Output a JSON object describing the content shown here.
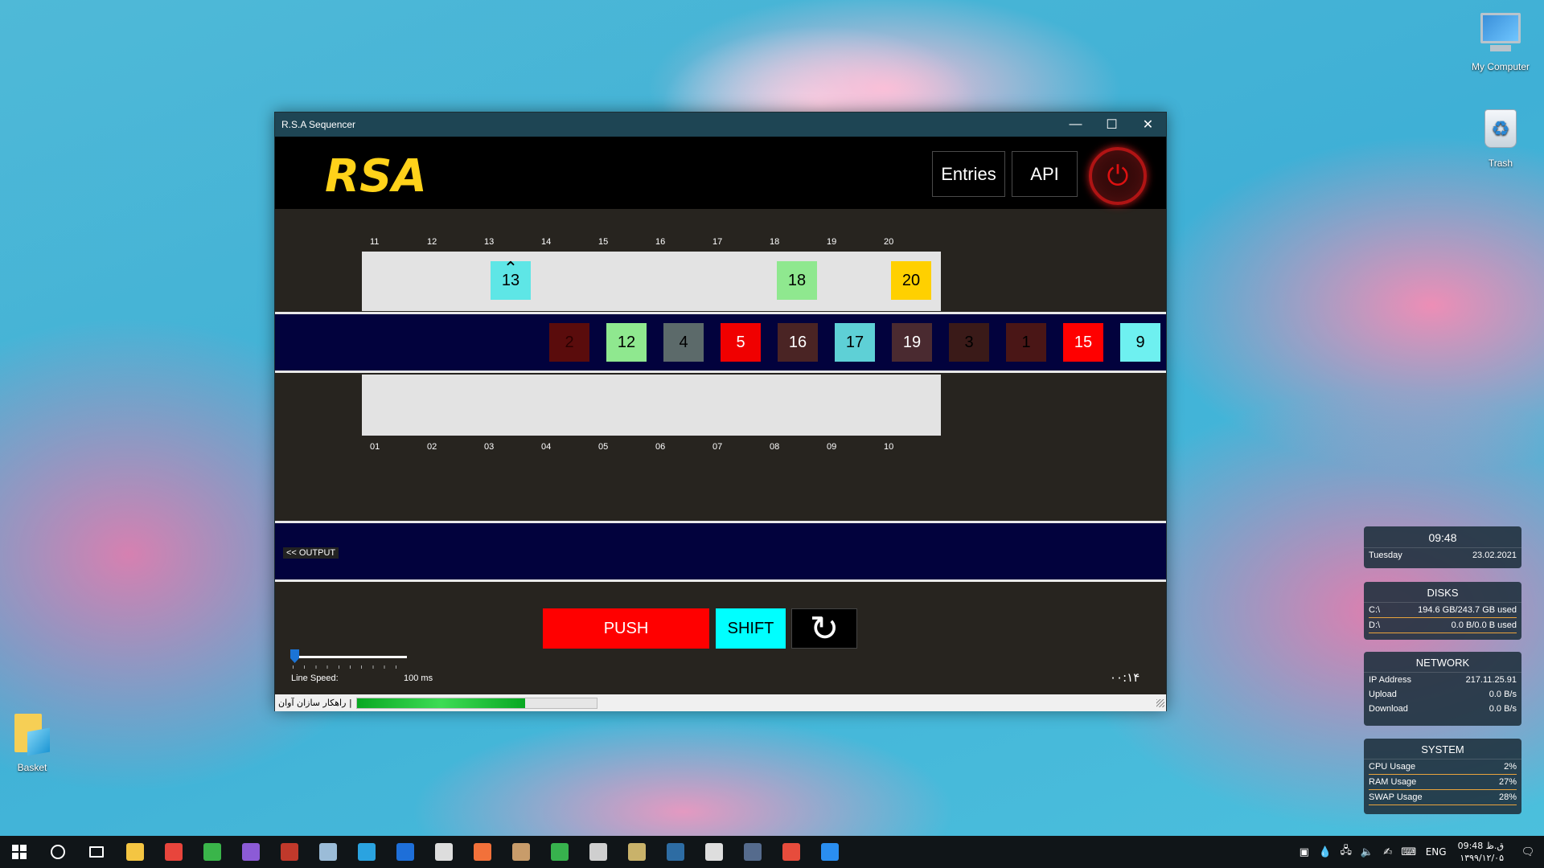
{
  "desktop": {
    "icons": [
      {
        "label": "My Computer"
      },
      {
        "label": "Trash"
      },
      {
        "label": "Basket"
      }
    ]
  },
  "window": {
    "title": "R.S.A Sequencer",
    "controls": {
      "minimize": "—",
      "maximize": "☐",
      "close": "✕"
    },
    "header": {
      "logo_text": "RSA",
      "entries_label": "Entries",
      "api_label": "API",
      "power_icon": "⏻"
    },
    "top_ticks": [
      "11",
      "12",
      "13",
      "14",
      "15",
      "16",
      "17",
      "18",
      "19",
      "20"
    ],
    "bottom_ticks": [
      "01",
      "02",
      "03",
      "04",
      "05",
      "06",
      "07",
      "08",
      "09",
      "10"
    ],
    "top_lane_boxes": [
      {
        "label": "13",
        "color": "#5ee6e6",
        "marker": "⌃"
      },
      {
        "label": "18",
        "color": "#8fe88f"
      },
      {
        "label": "20",
        "color": "#ffd000"
      }
    ],
    "conveyor_boxes": [
      {
        "label": "2",
        "color": "#5a0c0c",
        "text": "#2a0000"
      },
      {
        "label": "12",
        "color": "#8fe88f",
        "text": "#000"
      },
      {
        "label": "4",
        "color": "#5c6a6a",
        "text": "#000"
      },
      {
        "label": "5",
        "color": "#f00000",
        "text": "#fff"
      },
      {
        "label": "16",
        "color": "#4a2424",
        "text": "#fff"
      },
      {
        "label": "17",
        "color": "#5ed0d6",
        "text": "#000"
      },
      {
        "label": "19",
        "color": "#4a2a30",
        "text": "#fff"
      },
      {
        "label": "3",
        "color": "#3a1a18",
        "text": "#000"
      },
      {
        "label": "1",
        "color": "#4a1616",
        "text": "#000"
      },
      {
        "label": "15",
        "color": "#ff0000",
        "text": "#fff"
      },
      {
        "label": "9",
        "color": "#6ef0f0",
        "text": "#000"
      }
    ],
    "output_label": "<< OUTPUT",
    "controls_panel": {
      "push_label": "PUSH",
      "shift_label": "SHIFT",
      "reset_icon": "↻",
      "line_speed_label": "Line Speed:",
      "line_speed_value": "100 ms",
      "line_speed_level": 0.0,
      "timer": "۰۰:۱۴"
    },
    "statusbar": {
      "company": "راهکار سازان آوان",
      "separator": "|",
      "progress": 0.7
    }
  },
  "widgets": {
    "clock": {
      "time": "09:48",
      "day": "Tuesday",
      "date": "23.02.2021"
    },
    "disks": {
      "title": "DISKS",
      "rows": [
        {
          "label": "C:\\",
          "value": "194.6 GB/243.7 GB used"
        },
        {
          "label": "D:\\",
          "value": "0.0 B/0.0 B used"
        }
      ]
    },
    "network": {
      "title": "NETWORK",
      "rows": [
        {
          "label": "IP Address",
          "value": "217.11.25.91"
        },
        {
          "label": "Upload",
          "value": "0.0 B/s"
        },
        {
          "label": "Download",
          "value": "0.0 B/s"
        }
      ]
    },
    "system": {
      "title": "SYSTEM",
      "rows": [
        {
          "label": "CPU Usage",
          "value": "2%"
        },
        {
          "label": "RAM Usage",
          "value": "27%"
        },
        {
          "label": "SWAP Usage",
          "value": "28%"
        }
      ]
    }
  },
  "taskbar": {
    "start_icon": "windows-icon",
    "lang": "ENG",
    "time": "09:48 ق.ظ",
    "date": "۱۳۹۹/۱۲/۰۵",
    "apps": [
      {
        "name": "file-explorer-icon",
        "color": "#f4c542"
      },
      {
        "name": "chrome-icon",
        "color": "#e8453c"
      },
      {
        "name": "git-icon",
        "color": "#3ab54a"
      },
      {
        "name": "visual-studio-icon",
        "color": "#8c5bd6"
      },
      {
        "name": "mod-app-icon",
        "color": "#c0392b"
      },
      {
        "name": "notes-icon",
        "color": "#9bbcd8"
      },
      {
        "name": "telegram-icon",
        "color": "#2aa3e0"
      },
      {
        "name": "browser-icon",
        "color": "#1e6fd9"
      },
      {
        "name": "tools-icon",
        "color": "#dddddd"
      },
      {
        "name": "swift-icon",
        "color": "#f2713a"
      },
      {
        "name": "package-icon",
        "color": "#c89c6a"
      },
      {
        "name": "send-icon",
        "color": "#37b24d"
      },
      {
        "name": "printer-icon",
        "color": "#cfcfcf"
      },
      {
        "name": "sequencer-app-icon",
        "color": "#c9b26a"
      },
      {
        "name": "monitor-icon",
        "color": "#2d6ca3"
      },
      {
        "name": "excel-icon",
        "color": "#dedede"
      },
      {
        "name": "game-icon",
        "color": "#556b8d"
      },
      {
        "name": "cmake-icon",
        "color": "#e74c3c"
      },
      {
        "name": "vscode-icon",
        "color": "#2a8ef0"
      }
    ]
  }
}
